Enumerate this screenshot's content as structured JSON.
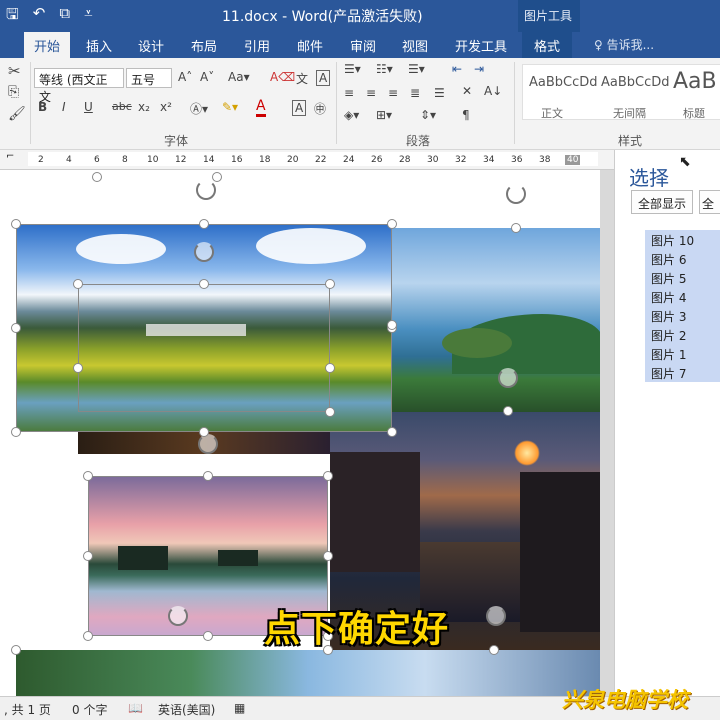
{
  "titlebar": {
    "doc_title": "11.docx - Word(产品激活失败)",
    "context_title": "图片工具",
    "qat": [
      "save-icon",
      "undo-icon",
      "redo-icon",
      "customize-icon"
    ]
  },
  "tabs": {
    "home": "开始",
    "insert": "插入",
    "design": "设计",
    "layout": "布局",
    "references": "引用",
    "mailings": "邮件",
    "review": "审阅",
    "view": "视图",
    "developer": "开发工具",
    "format": "格式",
    "tellme": "告诉我..."
  },
  "ribbon": {
    "font_name": "等线 (西文正文",
    "font_size": "五号",
    "font_group": "字体",
    "paragraph_group": "段落",
    "styles_group": "样式",
    "styles": [
      {
        "sample": "AaBbCcDd",
        "name": "正文"
      },
      {
        "sample": "AaBbCcDd",
        "name": "无间隔"
      },
      {
        "sample": "AaB",
        "name": "标题"
      }
    ],
    "bold": "B",
    "italic": "I",
    "underline": "U",
    "strike": "abc",
    "font_color_letter": "A"
  },
  "ruler": {
    "ticks": [
      "2",
      "4",
      "6",
      "8",
      "10",
      "12",
      "14",
      "16",
      "18",
      "20",
      "22",
      "24",
      "26",
      "28",
      "30",
      "32",
      "34",
      "36",
      "38",
      "40"
    ]
  },
  "pane": {
    "title": "选择",
    "show_all": "全部显示",
    "hide_all": "全",
    "items": [
      "图片 10",
      "图片 6",
      "图片 5",
      "图片 4",
      "图片 3",
      "图片 2",
      "图片 1",
      "图片 7"
    ]
  },
  "status": {
    "pages": ", 共 1 页",
    "words": "0 个字",
    "language": "英语(美国)"
  },
  "overlay": {
    "subtitle": "点下确定好",
    "watermark": "兴泉电脑学校"
  },
  "colors": {
    "accent": "#2b579a",
    "subtitle": "#ffd700",
    "selection": "#c9d8f3"
  }
}
